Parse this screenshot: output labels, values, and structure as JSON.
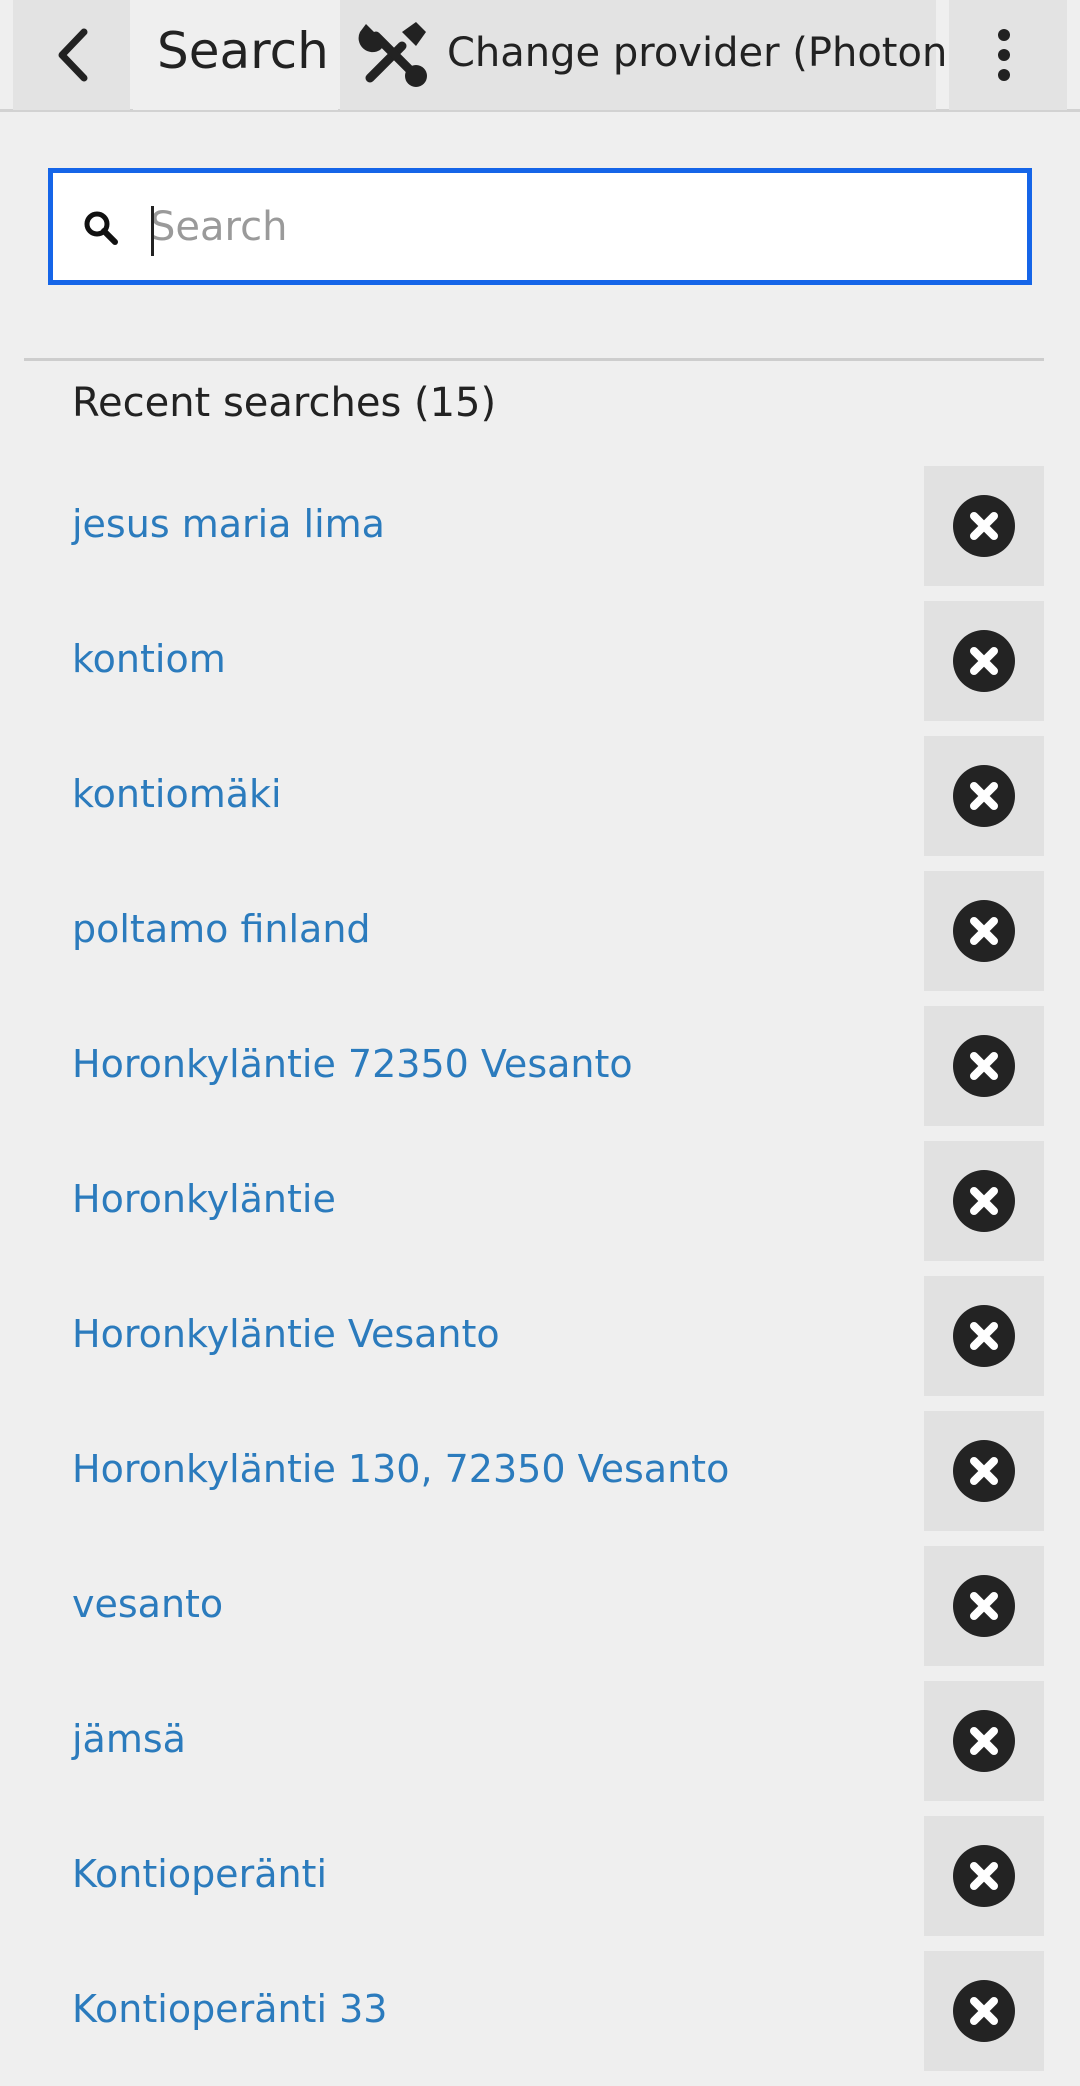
{
  "header": {
    "title": "Search",
    "provider_label": "Change provider (Photon)"
  },
  "search": {
    "placeholder": "Search",
    "value": ""
  },
  "recent": {
    "heading": "Recent searches (15)",
    "items": [
      "jesus maria lima",
      "kontiom",
      "kontiomäki",
      "poltamo finland",
      "Horonkyläntie 72350 Vesanto",
      "Horonkyläntie",
      "Horonkyläntie Vesanto",
      "Horonkyläntie 130, 72350 Vesanto",
      "vesanto",
      "jämsä",
      "Kontioperänti",
      "Kontioperänti 33"
    ]
  },
  "colors": {
    "accent": "#1565e8",
    "link": "#2b7bbd",
    "background": "#efefef"
  },
  "icons": {
    "back": "chevron-left-icon",
    "provider": "tools-icon",
    "menu": "more-vertical-icon",
    "search": "search-icon",
    "delete": "close-circle-icon"
  }
}
